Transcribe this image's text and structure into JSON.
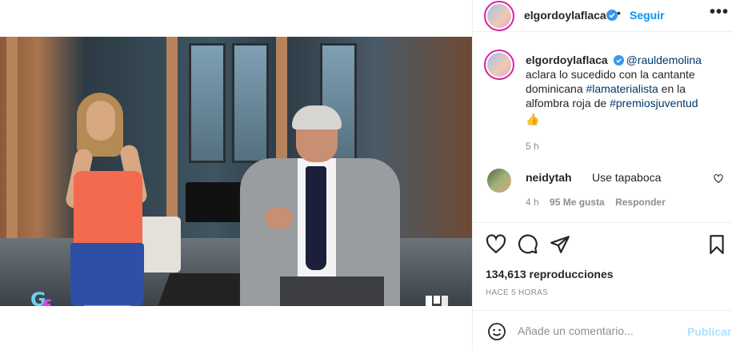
{
  "post": {
    "video_alt": "Video"
  },
  "header": {
    "username": "elgordoylaflaca",
    "dot": "•",
    "follow_label": "Seguir",
    "more_label": "•••"
  },
  "caption": {
    "username": "elgordoylaflaca",
    "mention": "@rauldemolina",
    "text_1": " aclara lo sucedido con la cantante dominicana ",
    "hashtag_1": "#lamaterialista",
    "text_2": " en la alfombra roja de ",
    "hashtag_2": "#premiosjuventud",
    "emoji": "👍",
    "time": "5 h"
  },
  "comment": {
    "username": "neidytah",
    "text": "Use tapaboca",
    "time": "4 h",
    "likes": "95 Me gusta",
    "reply_label": "Responder"
  },
  "stats": {
    "views": "134,613 reproducciones",
    "ago": "HACE 5 HORAS"
  },
  "add_comment": {
    "placeholder": "Añade un comentario...",
    "publish_label": "Publicar"
  },
  "overlay": {
    "logo_g": "G",
    "logo_f": "f"
  },
  "colors": {
    "accent": "#0095f6",
    "link": "#00376b",
    "muted": "#8e8e8e"
  }
}
